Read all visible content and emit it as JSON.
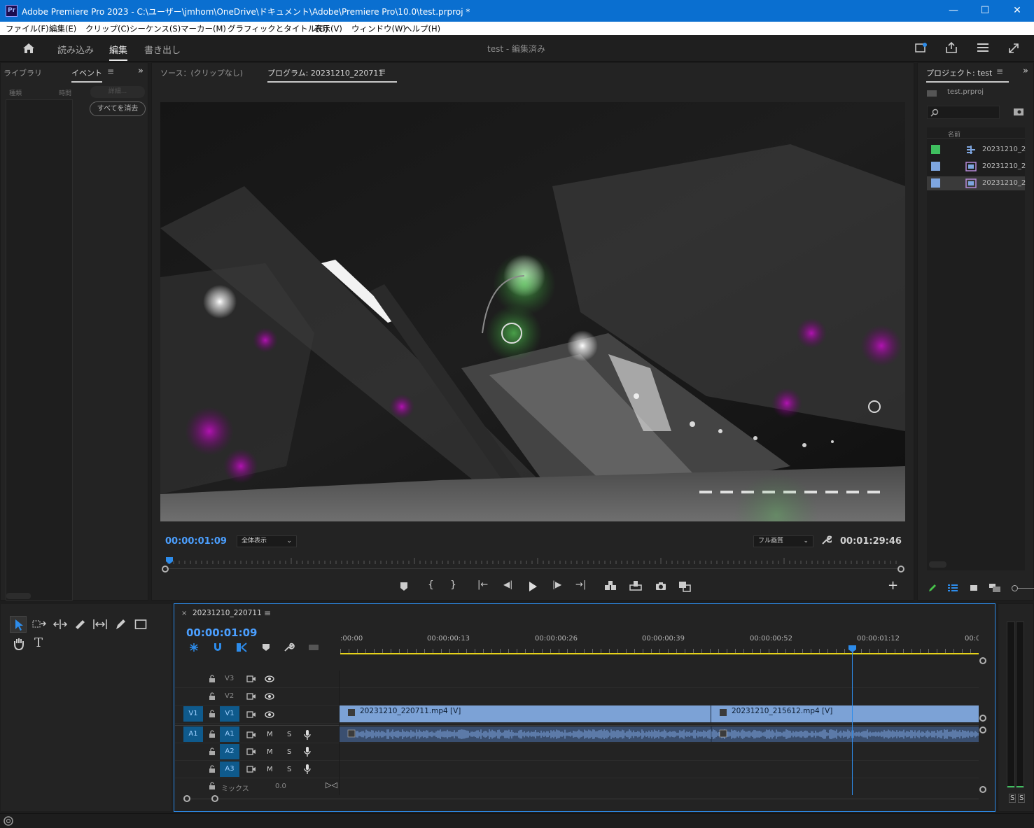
{
  "window": {
    "app_icon": "Pr",
    "title": "Adobe Premiere Pro 2023 - C:\\ユーザー\\jmhom\\OneDrive\\ドキュメント\\Adobe\\Premiere Pro\\10.0\\test.prproj *"
  },
  "menu": [
    "ファイル(F)",
    "編集(E)",
    "クリップ(C)",
    "シーケンス(S)",
    "マーカー(M)",
    "グラフィックとタイトル(G)",
    "表示(V)",
    "ウィンドウ(W)",
    "ヘルプ(H)"
  ],
  "workspace": {
    "tabs": [
      "読み込み",
      "編集",
      "書き出し"
    ],
    "active_tab": "編集",
    "project_status": "test - 編集済み"
  },
  "left_panel": {
    "tabs": [
      "ライブラリ",
      "イベント"
    ],
    "col_headers": [
      "種類",
      "時間"
    ],
    "details_label": "詳細...",
    "clear_all_label": "すべてを消去"
  },
  "monitor": {
    "source_tab": "ソース：(クリップなし)",
    "program_tab": "プログラム: 20231210_220711",
    "timecode": "00:00:01:09",
    "zoom_select": "全体表示",
    "quality_select": "フル画質",
    "duration": "00:01:29:46"
  },
  "project_panel": {
    "tab": "プロジェクト: test",
    "file": "test.prproj",
    "column_name": "名前",
    "items": [
      {
        "name": "20231210_2",
        "color": "#3fbf5f",
        "icon": "sequence-icon"
      },
      {
        "name": "20231210_2",
        "color": "#7ea6e0",
        "icon": "video-clip-icon"
      },
      {
        "name": "20231210_2",
        "color": "#7ea6e0",
        "icon": "video-clip-icon"
      }
    ]
  },
  "timeline": {
    "sequence_tab": "20231210_220711",
    "timecode": "00:00:01:09",
    "ruler": [
      ":00:00",
      "00:00:00:13",
      "00:00:00:26",
      "00:00:00:39",
      "00:00:00:52",
      "00:00:01:12",
      "00:0"
    ],
    "video_tracks": [
      {
        "name": "V3"
      },
      {
        "name": "V2"
      },
      {
        "name": "V1",
        "source": "V1"
      }
    ],
    "audio_tracks": [
      {
        "name": "A1",
        "source": "A1",
        "m": "M",
        "s": "S"
      },
      {
        "name": "A2",
        "m": "M",
        "s": "S"
      },
      {
        "name": "A3",
        "m": "M",
        "s": "S"
      }
    ],
    "mix_label": "ミックス",
    "mix_value": "0.0",
    "clips": [
      {
        "label": "20231210_220711.mp4 [V]"
      },
      {
        "label": "20231210_215612.mp4 [V]"
      }
    ]
  },
  "audio_meter": {
    "labels": [
      "S",
      "S"
    ]
  },
  "colors": {
    "accent": "#2d8ceb",
    "title_bar": "#0a6fd0",
    "clip_video": "#7ca2d6",
    "playhead": "#4b9fff"
  }
}
